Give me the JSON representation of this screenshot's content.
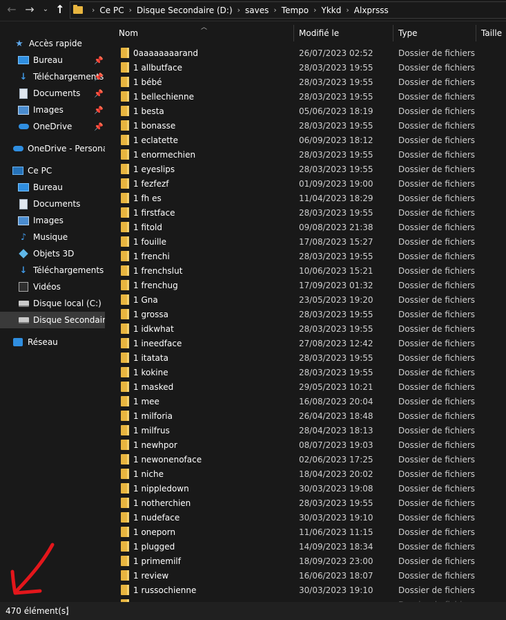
{
  "nav": {
    "back": "←",
    "forward": "→",
    "history": "⌄",
    "up": "↑"
  },
  "breadcrumb": [
    "Ce PC",
    "Disque Secondaire (D:)",
    "saves",
    "Tempo",
    "Ykkd",
    "Alxprsss"
  ],
  "sidebar": {
    "quick_access": "Accès rapide",
    "quick_items": [
      "Bureau",
      "Téléchargements",
      "Documents",
      "Images",
      "OneDrive"
    ],
    "onedrive_personal": "OneDrive - Personal",
    "this_pc": "Ce PC",
    "pc_items": [
      "Bureau",
      "Documents",
      "Images",
      "Musique",
      "Objets 3D",
      "Téléchargements",
      "Vidéos",
      "Disque local (C:)",
      "Disque Secondaire (D:)"
    ],
    "network": "Réseau"
  },
  "columns": {
    "name": "Nom",
    "modified": "Modifié le",
    "type": "Type",
    "size": "Taille"
  },
  "files": [
    {
      "name": "0aaaaaaaarand",
      "date": "26/07/2023 02:52",
      "type": "Dossier de fichiers"
    },
    {
      "name": "1 allbutface",
      "date": "28/03/2023 19:55",
      "type": "Dossier de fichiers"
    },
    {
      "name": "1 bébé",
      "date": "28/03/2023 19:55",
      "type": "Dossier de fichiers"
    },
    {
      "name": "1 bellechienne",
      "date": "28/03/2023 19:55",
      "type": "Dossier de fichiers"
    },
    {
      "name": "1 besta",
      "date": "05/06/2023 18:19",
      "type": "Dossier de fichiers"
    },
    {
      "name": "1 bonasse",
      "date": "28/03/2023 19:55",
      "type": "Dossier de fichiers"
    },
    {
      "name": "1 eclatette",
      "date": "06/09/2023 18:12",
      "type": "Dossier de fichiers"
    },
    {
      "name": "1 enormechien",
      "date": "28/03/2023 19:55",
      "type": "Dossier de fichiers"
    },
    {
      "name": "1 eyeslips",
      "date": "28/03/2023 19:55",
      "type": "Dossier de fichiers"
    },
    {
      "name": "1 fezfezf",
      "date": "01/09/2023 19:00",
      "type": "Dossier de fichiers"
    },
    {
      "name": "1 fh es",
      "date": "11/04/2023 18:29",
      "type": "Dossier de fichiers"
    },
    {
      "name": "1 firstface",
      "date": "28/03/2023 19:55",
      "type": "Dossier de fichiers"
    },
    {
      "name": "1 fitold",
      "date": "09/08/2023 21:38",
      "type": "Dossier de fichiers"
    },
    {
      "name": "1 fouille",
      "date": "17/08/2023 15:27",
      "type": "Dossier de fichiers"
    },
    {
      "name": "1 frenchi",
      "date": "28/03/2023 19:55",
      "type": "Dossier de fichiers"
    },
    {
      "name": "1 frenchslut",
      "date": "10/06/2023 15:21",
      "type": "Dossier de fichiers"
    },
    {
      "name": "1 frenchug",
      "date": "17/09/2023 01:32",
      "type": "Dossier de fichiers"
    },
    {
      "name": "1 Gna",
      "date": "23/05/2023 19:20",
      "type": "Dossier de fichiers"
    },
    {
      "name": "1 grossa",
      "date": "28/03/2023 19:55",
      "type": "Dossier de fichiers"
    },
    {
      "name": "1 idkwhat",
      "date": "28/03/2023 19:55",
      "type": "Dossier de fichiers"
    },
    {
      "name": "1 ineedface",
      "date": "27/08/2023 12:42",
      "type": "Dossier de fichiers"
    },
    {
      "name": "1 itatata",
      "date": "28/03/2023 19:55",
      "type": "Dossier de fichiers"
    },
    {
      "name": "1 kokine",
      "date": "28/03/2023 19:55",
      "type": "Dossier de fichiers"
    },
    {
      "name": "1 masked",
      "date": "29/05/2023 10:21",
      "type": "Dossier de fichiers"
    },
    {
      "name": "1 mee",
      "date": "16/08/2023 20:04",
      "type": "Dossier de fichiers"
    },
    {
      "name": "1 milforia",
      "date": "26/04/2023 18:48",
      "type": "Dossier de fichiers"
    },
    {
      "name": "1 milfrus",
      "date": "28/04/2023 18:13",
      "type": "Dossier de fichiers"
    },
    {
      "name": "1 newhpor",
      "date": "08/07/2023 19:03",
      "type": "Dossier de fichiers"
    },
    {
      "name": "1 newonenoface",
      "date": "02/06/2023 17:25",
      "type": "Dossier de fichiers"
    },
    {
      "name": "1 niche",
      "date": "18/04/2023 20:02",
      "type": "Dossier de fichiers"
    },
    {
      "name": "1 nippledown",
      "date": "30/03/2023 19:08",
      "type": "Dossier de fichiers"
    },
    {
      "name": "1 notherchien",
      "date": "28/03/2023 19:55",
      "type": "Dossier de fichiers"
    },
    {
      "name": "1 nudeface",
      "date": "30/03/2023 19:10",
      "type": "Dossier de fichiers"
    },
    {
      "name": "1 oneporn",
      "date": "11/06/2023 11:15",
      "type": "Dossier de fichiers"
    },
    {
      "name": "1 plugged",
      "date": "14/09/2023 18:34",
      "type": "Dossier de fichiers"
    },
    {
      "name": "1 primemilf",
      "date": "18/09/2023 23:00",
      "type": "Dossier de fichiers"
    },
    {
      "name": "1 review",
      "date": "16/06/2023 18:07",
      "type": "Dossier de fichiers"
    },
    {
      "name": "1 russochienne",
      "date": "30/03/2023 19:10",
      "type": "Dossier de fichiers"
    }
  ],
  "partial_row": {
    "type": "Dossier de fichiers"
  },
  "status": {
    "count": "470 élément(s)",
    "separator": "|"
  },
  "colors": {
    "background": "#191919",
    "folder": "#e8b53f",
    "selected": "#3a3a3a",
    "annotation": "#e3161b"
  }
}
